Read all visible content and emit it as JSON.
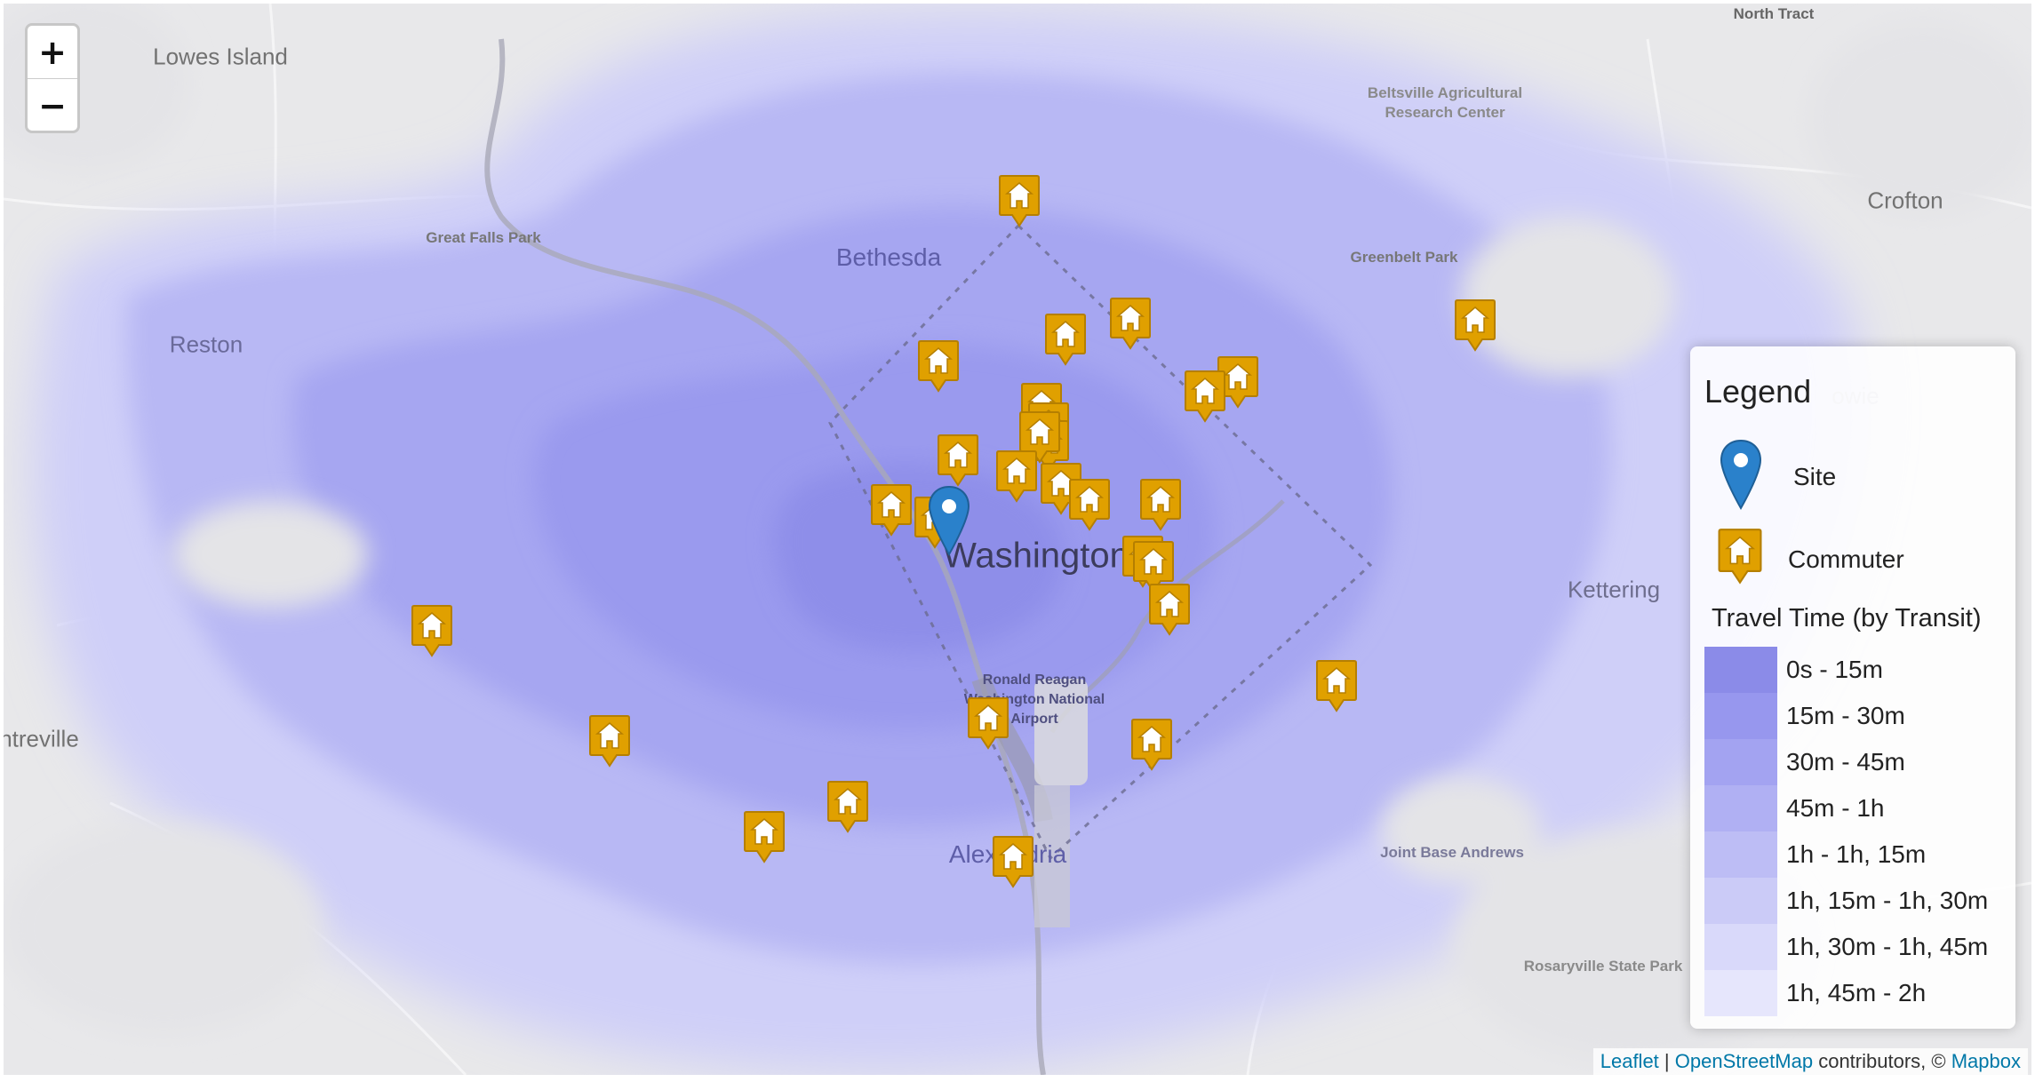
{
  "map": {
    "zoom_in_label": "+",
    "zoom_out_label": "−",
    "place_labels": [
      {
        "text": "North Tract",
        "style": "small-plain"
      },
      {
        "text": "Lowes Island",
        "style": "big"
      },
      {
        "text": "Beltsville Agricultural Research Center",
        "style": "small"
      },
      {
        "text": "Crofton",
        "style": "big"
      },
      {
        "text": "Great Falls Park",
        "style": "small"
      },
      {
        "text": "Bethesda",
        "style": "city"
      },
      {
        "text": "Greenbelt Park",
        "style": "small"
      },
      {
        "text": "Reston",
        "style": "big"
      },
      {
        "text": "Washington",
        "style": "capital"
      },
      {
        "text": "Kettering",
        "style": "big"
      },
      {
        "text": "Ronald Reagan Washington National Airport",
        "style": "airport"
      },
      {
        "text": "ntreville",
        "style": "big"
      },
      {
        "text": "Alexandria",
        "style": "city"
      },
      {
        "text": "Joint Base Andrews",
        "style": "small"
      },
      {
        "text": "Rosaryville State Park",
        "style": "small"
      },
      {
        "text": "owie",
        "style": "big"
      }
    ]
  },
  "legend": {
    "title": "Legend",
    "site_label": "Site",
    "commuter_label": "Commuter",
    "travel_time_title": "Travel Time (by Transit)",
    "travel_time_bins": [
      {
        "label": "0s - 15m",
        "color": "#8b8be8"
      },
      {
        "label": "15m - 30m",
        "color": "#9797ee"
      },
      {
        "label": "30m - 45m",
        "color": "#a3a3f1"
      },
      {
        "label": "45m - 1h",
        "color": "#b0b0f3"
      },
      {
        "label": "1h - 1h, 15m",
        "color": "#bdbdf5"
      },
      {
        "label": "1h, 15m - 1h, 30m",
        "color": "#cbcbf7"
      },
      {
        "label": "1h, 30m - 1h, 45m",
        "color": "#d9d9fa"
      },
      {
        "label": "1h, 45m - 2h",
        "color": "#e6e6fc"
      }
    ],
    "site_color": "#2a81cb",
    "commuter_color": "#e0a000"
  },
  "attribution": {
    "leaflet": "Leaflet",
    "separator": "|",
    "osm": "OpenStreetMap",
    "contributors": "contributors, ©",
    "mapbox": "Mapbox"
  }
}
